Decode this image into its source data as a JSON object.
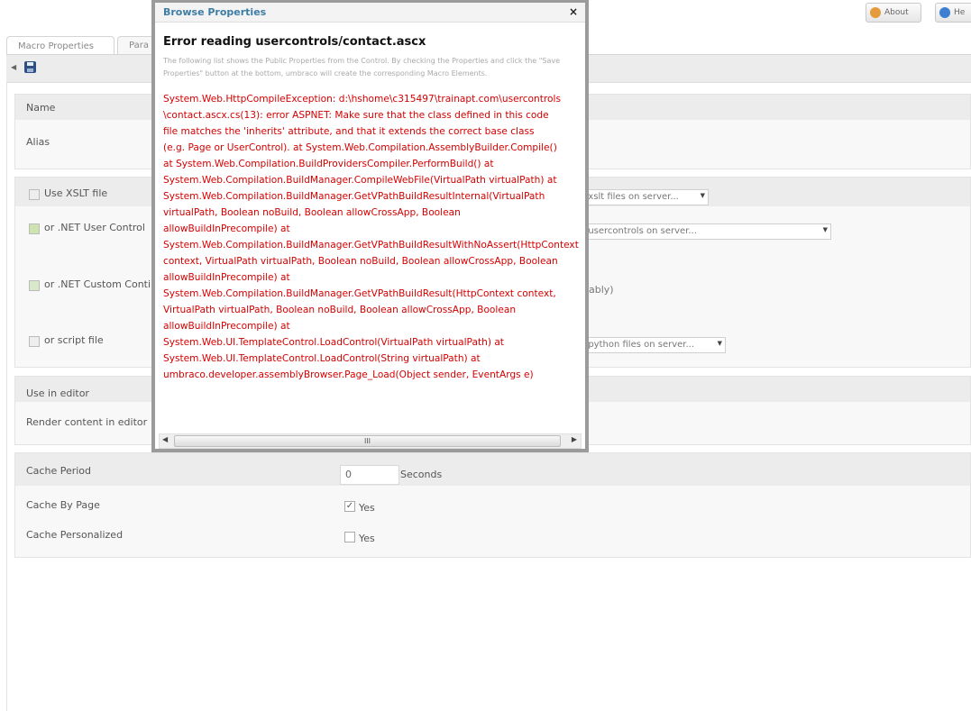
{
  "header": {
    "about_label": "About",
    "help_label": "He"
  },
  "tabs": [
    {
      "label": "Macro Properties"
    },
    {
      "label": "Para"
    }
  ],
  "form": {
    "name_label": "Name",
    "alias_label": "Alias",
    "xslt_label": "Use XSLT file",
    "xslt_dropdown": "e xslt files on server...",
    "usercontrol_label": "or .NET User Control",
    "usercontrol_dropdown": "e usercontrols on server...",
    "customcontrol_label": "or .NET Custom Conti",
    "customcontrol_suffix": "ably)",
    "script_label": "or script file",
    "script_dropdown": "e python files on server...",
    "use_in_editor_label": "Use in editor",
    "render_content_label": "Render content in editor",
    "cache_period_label": "Cache Period",
    "cache_period_value": "0",
    "cache_period_unit": "Seconds",
    "cache_by_page_label": "Cache By Page",
    "cache_by_page_checked": true,
    "cache_by_page_text": "Yes",
    "cache_personalized_label": "Cache Personalized",
    "cache_personalized_checked": false,
    "cache_personalized_text": "Yes"
  },
  "modal": {
    "title": "Browse Properties",
    "close_glyph": "×",
    "error_heading": "Error reading usercontrols/contact.ascx",
    "info_text": "The following list shows the Public Properties from the Control. By checking the Properties and click the \"Save Properties\" button at the bottom, umbraco will create the corresponding Macro Elements.",
    "error_text": "System.Web.HttpCompileException: d:\\hshome\\c315497\\trainapt.com\\usercontrols\n\\contact.ascx.cs(13): error ASPNET: Make sure that the class defined in this code\nfile matches the 'inherits' attribute, and that it extends the correct base class\n(e.g. Page or UserControl). at System.Web.Compilation.AssemblyBuilder.Compile()\nat System.Web.Compilation.BuildProvidersCompiler.PerformBuild() at\nSystem.Web.Compilation.BuildManager.CompileWebFile(VirtualPath virtualPath) at\nSystem.Web.Compilation.BuildManager.GetVPathBuildResultInternal(VirtualPath\nvirtualPath, Boolean noBuild, Boolean allowCrossApp, Boolean\nallowBuildInPrecompile) at\nSystem.Web.Compilation.BuildManager.GetVPathBuildResultWithNoAssert(HttpContext\ncontext, VirtualPath virtualPath, Boolean noBuild, Boolean allowCrossApp, Boolean\nallowBuildInPrecompile) at\nSystem.Web.Compilation.BuildManager.GetVPathBuildResult(HttpContext context,\nVirtualPath virtualPath, Boolean noBuild, Boolean allowCrossApp, Boolean\nallowBuildInPrecompile) at\nSystem.Web.UI.TemplateControl.LoadControl(VirtualPath virtualPath) at\nSystem.Web.UI.TemplateControl.LoadControl(String virtualPath) at\numbraco.developer.assemblyBrowser.Page_Load(Object sender, EventArgs e)",
    "scroll_left_glyph": "◀",
    "scroll_right_glyph": "▶",
    "scroll_thumb_glyph": "III"
  },
  "colors": {
    "error_text": "#d40000",
    "modal_title": "#3e7da4",
    "modal_frame": "#9b9b9b"
  }
}
